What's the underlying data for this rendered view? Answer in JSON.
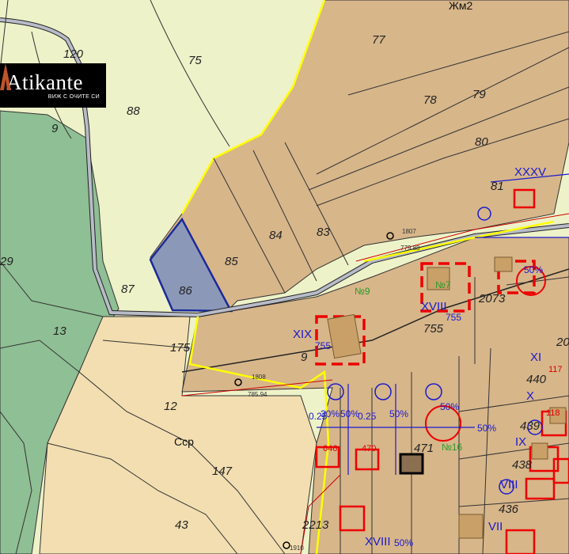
{
  "logo": {
    "name": "Atikante",
    "tagline": "ВИЖ С ОЧИТЕ СИ"
  },
  "zones": {
    "zm2": "Жм2",
    "ssr": "Сср"
  },
  "parcels": [
    "77",
    "120",
    "75",
    "88",
    "9",
    "78",
    "79",
    "80",
    "84",
    "83",
    "85",
    "86",
    "87",
    "29",
    "13",
    "81",
    "755",
    "175",
    "9",
    "12",
    "147",
    "43",
    "2213",
    "471",
    "2073",
    "440",
    "439",
    "438",
    "436",
    "117",
    "118",
    "20",
    "1807",
    "1808",
    "1910",
    "470",
    "646"
  ],
  "roman": [
    "XXXV",
    "XIX",
    "XVIII",
    "XI",
    "X",
    "IX",
    "VIII",
    "VII",
    "XVIII"
  ],
  "labels": {
    "no9": "№9",
    "no7": "№7",
    "no16": "№16",
    "pt1807": "1807",
    "pt1808": "1808",
    "elev1": "779.88",
    "elev2": "785.94",
    "parcel755a": "755",
    "parcel755b": "755",
    "pct": "50%",
    "pct30": "30%",
    "v1": "0.25",
    "v2": "0.25"
  },
  "colors": {
    "forest": "#8fbf94",
    "yellowish": "#f0f3cc",
    "tan": "#d7b68a",
    "light_tan": "#f2deb0",
    "blue_parcel": "#8c98b8",
    "red": "#dd0000",
    "blue": "#1a1ad0",
    "yellow": "#ffff00"
  }
}
